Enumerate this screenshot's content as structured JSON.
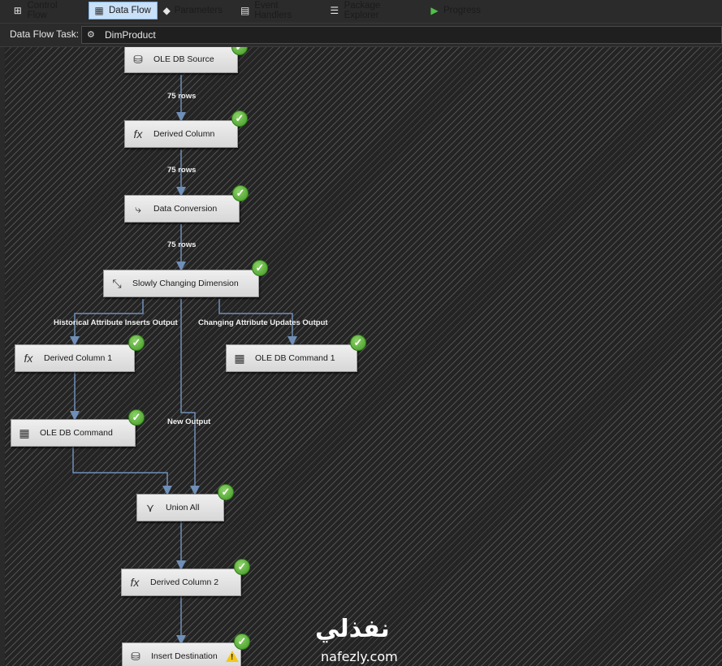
{
  "tabs": [
    {
      "label": "Control Flow",
      "icon": "control-flow-icon",
      "active": false
    },
    {
      "label": "Data Flow",
      "icon": "data-flow-icon",
      "active": true
    },
    {
      "label": "Parameters",
      "icon": "parameters-icon",
      "active": false
    },
    {
      "label": "Event Handlers",
      "icon": "event-handlers-icon",
      "active": false
    },
    {
      "label": "Package Explorer",
      "icon": "package-explorer-icon",
      "active": false
    },
    {
      "label": "Progress",
      "icon": "progress-play-icon",
      "active": false
    }
  ],
  "task": {
    "label": "Data Flow Task:",
    "value": "DimProduct"
  },
  "components": {
    "ole_db_source": "OLE DB Source",
    "derived_column": "Derived Column",
    "data_conversion": "Data Conversion",
    "scd": "Slowly Changing Dimension",
    "derived_column_1": "Derived Column 1",
    "ole_db_command_1": "OLE DB Command 1",
    "ole_db_command": "OLE DB Command",
    "union_all": "Union All",
    "derived_column_2": "Derived Column 2",
    "insert_destination": "Insert Destination"
  },
  "paths": {
    "rows1": "75 rows",
    "rows2": "75 rows",
    "rows3": "75 rows",
    "historical": "Historical Attribute Inserts Output",
    "changing": "Changing Attribute Updates Output",
    "new_output": "New Output"
  },
  "watermark": {
    "arabic": "نفذلي",
    "latin": "nafezly.com"
  },
  "colors": {
    "canvas": "#242424",
    "path_line": "#6f8fb8",
    "check": "#4caf2c",
    "active_tab": "#c9e0f7"
  }
}
